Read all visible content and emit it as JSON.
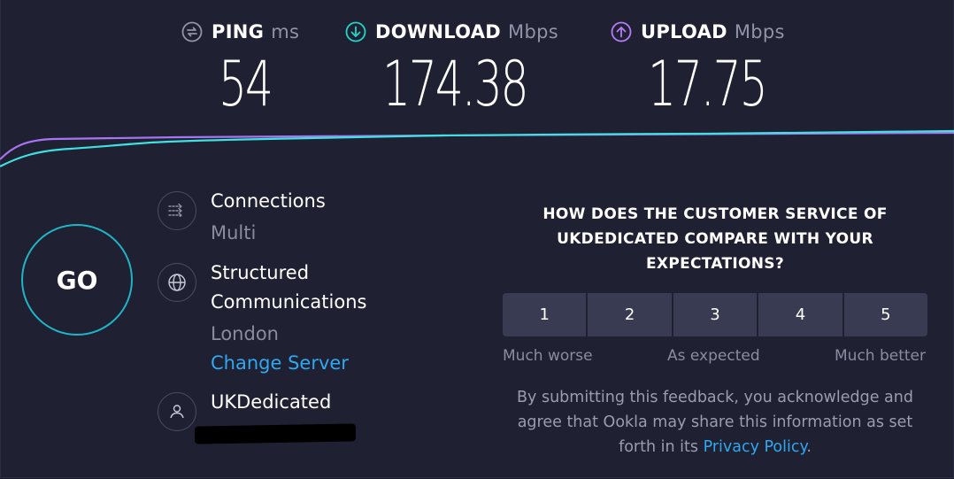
{
  "metrics": {
    "ping": {
      "label": "PING",
      "unit": "ms",
      "value": "54",
      "icon": "ping-icon",
      "color": "#9193a8"
    },
    "download": {
      "label": "DOWNLOAD",
      "unit": "Mbps",
      "value": "174.38",
      "icon": "download-arrow-icon",
      "color": "#1fd6c8"
    },
    "upload": {
      "label": "UPLOAD",
      "unit": "Mbps",
      "value": "17.75",
      "icon": "upload-arrow-icon",
      "color": "#b57cf5"
    }
  },
  "go_label": "GO",
  "connections": {
    "title": "Connections",
    "value": "Multi",
    "icon": "connections-icon"
  },
  "server": {
    "name_line1": "Structured",
    "name_line2": "Communications",
    "location": "London",
    "change_link": "Change Server",
    "icon": "globe-icon"
  },
  "provider": {
    "name": "UKDedicated",
    "icon": "user-icon"
  },
  "survey": {
    "question": "HOW DOES THE CUSTOMER SERVICE OF UKDEDICATED COMPARE WITH YOUR EXPECTATIONS?",
    "ratings": [
      "1",
      "2",
      "3",
      "4",
      "5"
    ],
    "scale_low": "Much worse",
    "scale_mid": "As expected",
    "scale_high": "Much better",
    "disclaimer_prefix": "By submitting this feedback, you acknowledge and agree that Ookla may share this information as set forth in its",
    "privacy_link": "Privacy Policy",
    "disclaimer_suffix": "."
  },
  "colors": {
    "background": "#1f2032",
    "go_ring": "#1fb5c6",
    "download_line": "#3fe0e0",
    "upload_line": "#a774f2",
    "link": "#2fa8f0"
  }
}
